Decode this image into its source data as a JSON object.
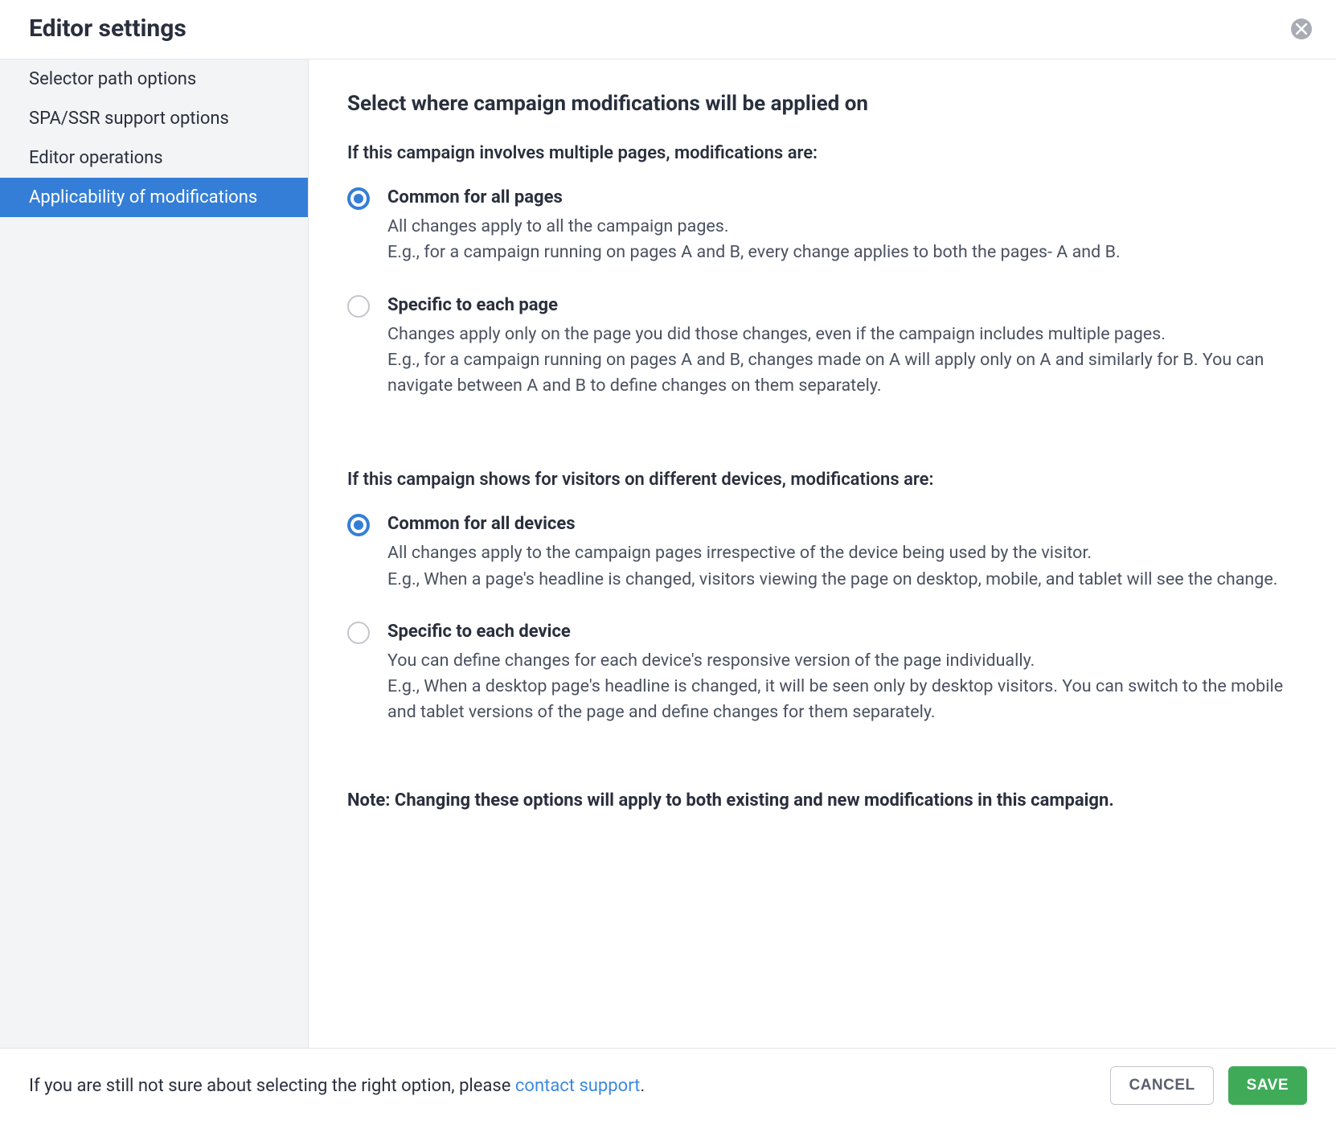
{
  "header": {
    "title": "Editor settings"
  },
  "sidebar": {
    "items": [
      {
        "label": "Selector path options",
        "active": false
      },
      {
        "label": "SPA/SSR support options",
        "active": false
      },
      {
        "label": "Editor operations",
        "active": false
      },
      {
        "label": "Applicability of modifications",
        "active": true
      }
    ]
  },
  "main": {
    "title": "Select where campaign modifications will be applied on",
    "section1": {
      "label": "If this campaign involves multiple pages, modifications are:",
      "options": [
        {
          "title": "Common for all pages",
          "desc": "All changes apply to all the campaign pages.\nE.g., for a campaign running on pages A and B, every change applies to both the pages- A and B.",
          "selected": true
        },
        {
          "title": "Specific to each page",
          "desc": "Changes apply only on the page you did those changes, even if the campaign includes multiple pages.\nE.g., for a campaign running on pages A and B, changes made on A will apply only on A and similarly for B. You can navigate between A and B to define changes on them separately.",
          "selected": false
        }
      ]
    },
    "section2": {
      "label": "If this campaign shows for visitors on different devices, modifications are:",
      "options": [
        {
          "title": "Common for all devices",
          "desc": "All changes apply to the campaign pages irrespective of the device being used by the visitor.\nE.g., When a page's headline is changed, visitors viewing the page on desktop, mobile, and tablet will see the change.",
          "selected": true
        },
        {
          "title": "Specific to each device",
          "desc": "You can define changes for each device's responsive version of the page individually.\nE.g., When a desktop page's headline is changed, it will be seen only by desktop visitors. You can switch to the mobile and tablet versions of the page and define changes for them separately.",
          "selected": false
        }
      ]
    },
    "note": "Note: Changing these options will apply to both existing and new modifications in this campaign."
  },
  "footer": {
    "text_prefix": "If you are still not sure about selecting the right option, please ",
    "link": "contact support",
    "text_suffix": ".",
    "cancel": "CANCEL",
    "save": "SAVE"
  }
}
